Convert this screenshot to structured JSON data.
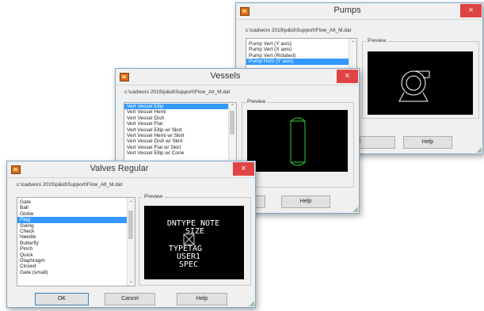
{
  "pumps": {
    "title": "Pumps",
    "close": "×",
    "path": "c:\\cadworx 2019\\p&id\\Support\\Flow_Alt_M.dat",
    "items": [
      "Pump Vert (Y axis)",
      "Pump Vert (X axis)",
      "Pump Vert (Rotated)",
      "Pump Horz (Y axis)"
    ],
    "selected_index": 3,
    "preview_label": "Preview",
    "buttons": {
      "cancel": "cel",
      "help": "Help"
    }
  },
  "vessels": {
    "title": "Vessels",
    "close": "×",
    "path": "c:\\cadworx 2019\\p&id\\Support\\Flow_Alt_M.dat",
    "items": [
      "Vert Vessel Ellip",
      "Vert Vessel Hemi",
      "Vert Vessel Dish",
      "Vert Vessel Flat",
      "Vert Vessel Ellip w/ Skirt",
      "Vert Vessel Hemi w/ Skirt",
      "Vert Vessel Dish w/ Skirt",
      "Vert Vessel Flat w/ Skirt",
      "Vert Vessel Ellip w/ Cone"
    ],
    "selected_index": 0,
    "preview_label": "Preview",
    "buttons": {
      "cancel": "cel",
      "help": "Help"
    }
  },
  "valves": {
    "title": "Valves Regular",
    "close": "×",
    "path": "c:\\cadworx 2015\\p&id\\Support\\Flow_Alt_M.dat",
    "items": [
      "Gate",
      "Ball",
      "Globe",
      "Plug",
      "Swing",
      "Check",
      "Needle",
      "Butterfly",
      "Pinch",
      "Quick",
      "Diaphragm",
      "Closed",
      "Gate (small)"
    ],
    "selected_index": 3,
    "preview_label": "Preview",
    "preview_text": [
      "DNTYPE NOTE",
      "SIZE",
      "TYPETAG",
      "USER1",
      "SPEC"
    ],
    "buttons": {
      "ok": "OK",
      "cancel": "Cancel",
      "help": "Help"
    }
  },
  "colors": {
    "selection": "#3399ff",
    "close": "#e04343",
    "preview_bg": "#000000",
    "pump_line": "#ffffff",
    "vessel_line": "#33cc33",
    "text_line": "#ffffff"
  },
  "icons": [
    "app-icon",
    "close-icon",
    "scroll-up-arrow",
    "scroll-down-arrow",
    "resize-grip-icon"
  ]
}
